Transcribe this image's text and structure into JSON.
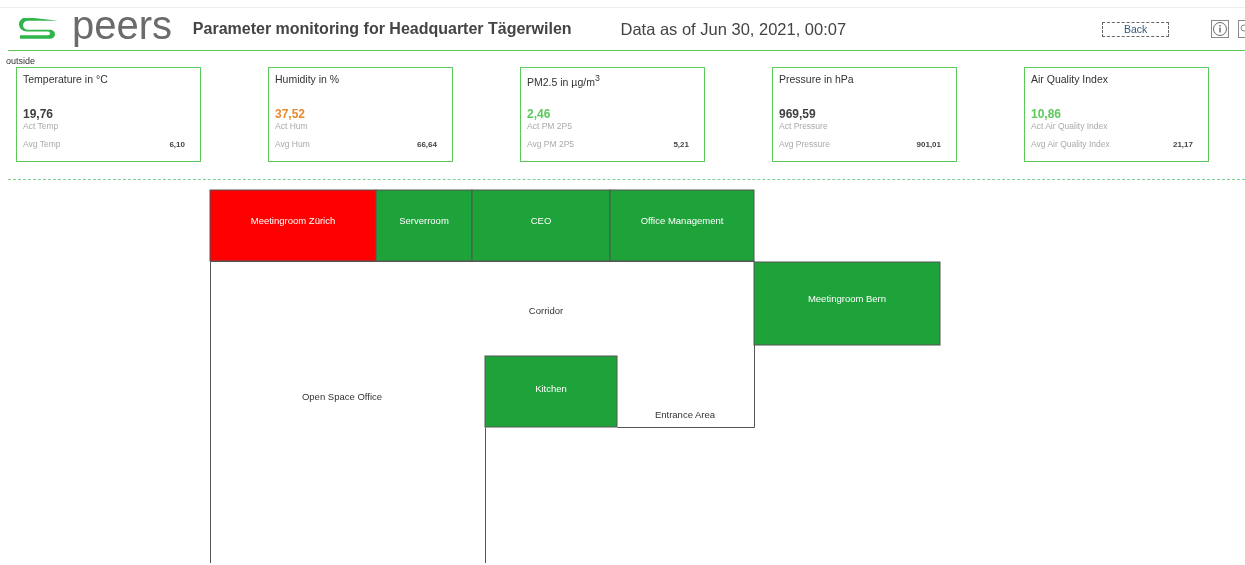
{
  "header": {
    "logo_text": "peers",
    "title": "Parameter monitoring for Headquarter Tägerwilen",
    "timestamp": "Data as of Jun 30, 2021, 00:07",
    "back_button": "Back"
  },
  "section_label": "outside",
  "cards": [
    {
      "title": "Temperature in °C",
      "value": "19,76",
      "color": "#3f3f3f",
      "value_label": "Act Temp",
      "avg_label": "Avg Temp",
      "avg_value": "6,10"
    },
    {
      "title": "Humidity in %",
      "value": "37,52",
      "color": "#e8892b",
      "value_label": "Act Hum",
      "avg_label": "Avg Hum",
      "avg_value": "66,64"
    },
    {
      "title": "PM2.5 in µg/m$^{3}$",
      "value": "2,46",
      "color": "#5cc95c",
      "value_label": "Act PM 2P5",
      "avg_label": "Avg PM 2P5",
      "avg_value": "5,21"
    },
    {
      "title": "Pressure in hPa",
      "value": "969,59",
      "color": "#3f3f3f",
      "value_label": "Act Pressure",
      "avg_label": "Avg Pressure",
      "avg_value": "901,01"
    },
    {
      "title": "Air Quality Index",
      "value": "10,86",
      "color": "#5cc95c",
      "value_label": "Act Air Quality Index",
      "avg_label": "Avg Air Quality Index",
      "avg_value": "21,17"
    }
  ],
  "rooms": [
    {
      "name": "Meetingroom Zürich",
      "color": "#ff0000"
    },
    {
      "name": "Serverroom",
      "color": "#1ea33a"
    },
    {
      "name": "CEO",
      "color": "#1ea33a"
    },
    {
      "name": "Office Management",
      "color": "#1ea33a"
    },
    {
      "name": "Corridor"
    },
    {
      "name": "Meetingroom Bern",
      "color": "#1ea33a"
    },
    {
      "name": "Kitchen",
      "color": "#1ea33a"
    },
    {
      "name": "Open Space Office"
    },
    {
      "name": "Entrance Area"
    }
  ]
}
